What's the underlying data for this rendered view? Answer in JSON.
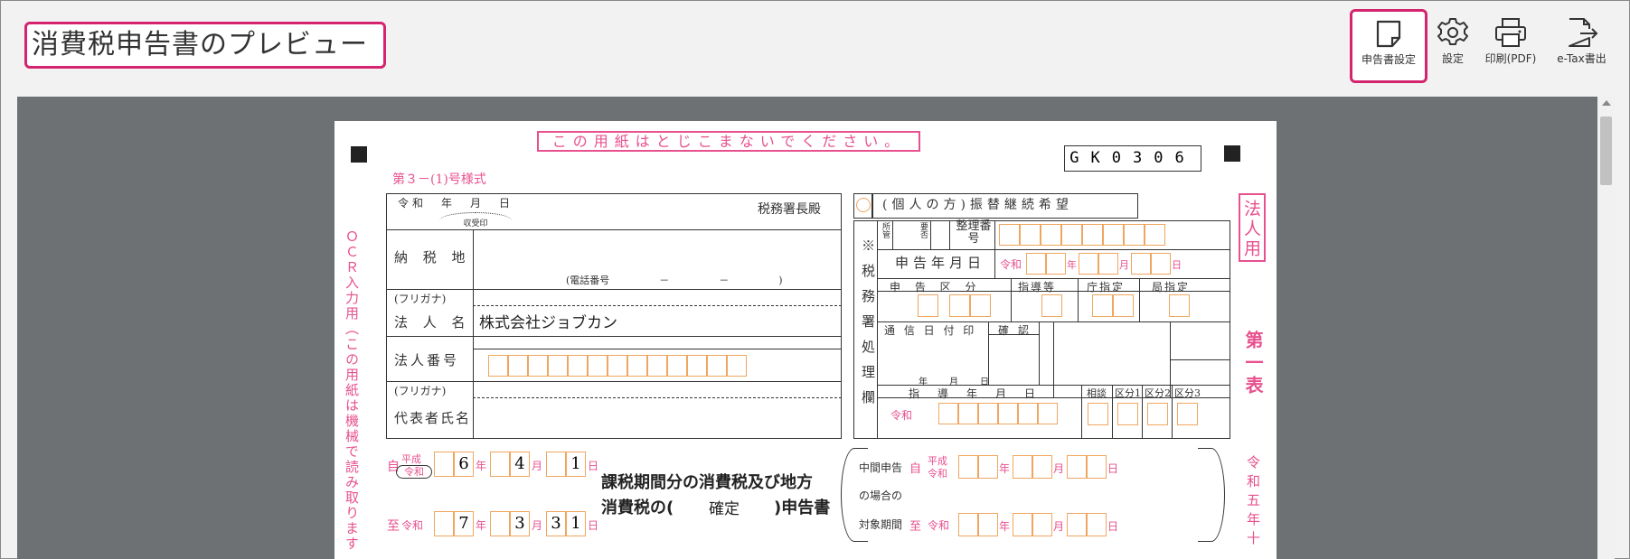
{
  "header": {
    "title": "消費税申告書のプレビュー"
  },
  "toolbar": {
    "items": [
      {
        "label": "申告書設定",
        "icon": "document-icon"
      },
      {
        "label": "設定",
        "icon": "gear-icon"
      },
      {
        "label": "印刷(PDF)",
        "icon": "printer-icon"
      },
      {
        "label": "e-Tax書出",
        "icon": "export-icon"
      }
    ]
  },
  "form": {
    "notice": "この用紙はとじこまないでください。",
    "code": "GK0306",
    "form_no": "第３－(1)号様式",
    "date_label": "令和　年　月　日",
    "office": "税務署長殿",
    "stamp": "収受印",
    "address_label": "納 税 地",
    "phone_label": "(電話番号　　　　　－　　　　　－　　　　　)",
    "furigana": "(フリガナ)",
    "corp_name_label": "法 人 名",
    "corp_name": "株式会社ジョブカン",
    "corp_no_label": "法人番号",
    "rep_furigana": "(フリガナ)",
    "rep_label": "代表者氏名",
    "period_from_label": "自",
    "period_from_era": "平成",
    "period_from_era2": "令和",
    "from_y": "6",
    "from_m": "4",
    "from_d": "1",
    "period_to_label": "至",
    "period_to_era": "令和",
    "to_y": "7",
    "to_m": "3",
    "to_d1": "3",
    "to_d2": "1",
    "year_u": "年",
    "month_u": "月",
    "day_u": "日",
    "title_1": "課税期間分の消費税及び地方",
    "title_2": "消費税の(",
    "title_kind": "確定",
    "title_3": ")申告書",
    "transfer": "(個人の方)振替継続希望",
    "side_ocr": "ＯＣＲ入力用（この用紙は機械で読み取ります",
    "corp_use": "法人用",
    "first_table": "第一表",
    "side_reiwa": "令和五年十",
    "tax_office_col": "※税務署処理欄",
    "seiri": "整理番号",
    "shomei": "所管",
    "yoshi": "要否",
    "shinkoku_date": "申告年月日",
    "reiwa": "令和",
    "shinkoku_kubun": "申 告 区 分",
    "shidoto": "指導等",
    "cho_shitei": "庁指定",
    "kyoku_shitei": "局指定",
    "tsushin": "通 信 日 付 印",
    "kakunin": "確 認",
    "nen": "年",
    "tsuki": "月",
    "hi": "日",
    "shido_ymd": "指　導　年　月　日",
    "sodan": "相談",
    "kubun1": "区分1",
    "kubun2": "区分2",
    "kubun3": "区分3",
    "interim_1": "中間申告",
    "interim_2": "の場合の",
    "interim_3": "対象期間",
    "interim_from": "自",
    "interim_to": "至",
    "heisei": "平成",
    "reiwa2": "令和"
  }
}
